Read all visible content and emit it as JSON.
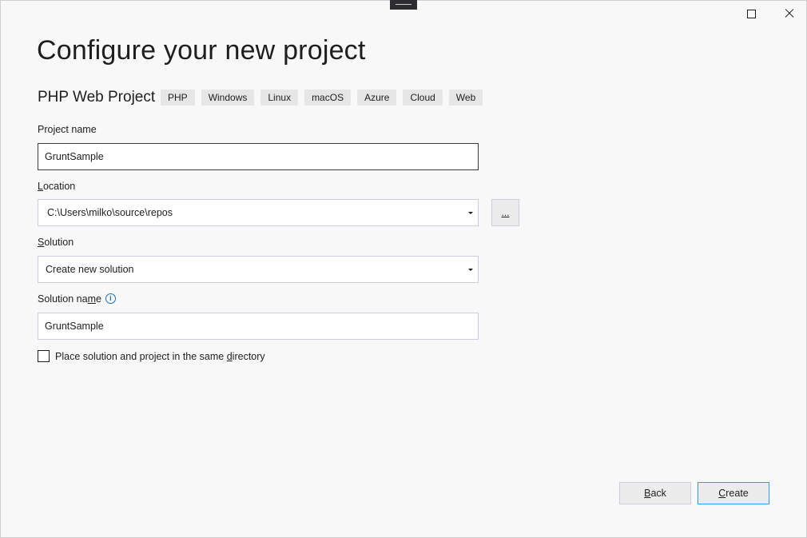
{
  "window": {
    "maximize_icon": "maximize-icon",
    "close_icon": "close-icon"
  },
  "header": {
    "title": "Configure your new project",
    "template_name": "PHP Web Project",
    "tags": [
      "PHP",
      "Windows",
      "Linux",
      "macOS",
      "Azure",
      "Cloud",
      "Web"
    ]
  },
  "form": {
    "project_name": {
      "label": "Project name",
      "value": "GruntSample"
    },
    "location": {
      "label_access_key": "L",
      "label_rest": "ocation",
      "value": "C:\\Users\\milko\\source\\repos",
      "browse_label": "..."
    },
    "solution": {
      "label_access_key": "S",
      "label_rest": "olution",
      "value": "Create new solution"
    },
    "solution_name": {
      "label_before": "Solution na",
      "label_access_key": "m",
      "label_after": "e",
      "info_icon": "info-icon",
      "value": "GruntSample"
    },
    "same_directory": {
      "label_before": "Place solution and project in the same ",
      "label_access_key": "d",
      "label_after": "irectory",
      "checked": false
    }
  },
  "footer": {
    "back": {
      "access_key": "B",
      "rest": "ack"
    },
    "create": {
      "access_key": "C",
      "rest": "reate"
    }
  },
  "colors": {
    "background": "#f8f8f8",
    "info_accent": "#1a73b8",
    "focus_border": "#3399ff"
  }
}
